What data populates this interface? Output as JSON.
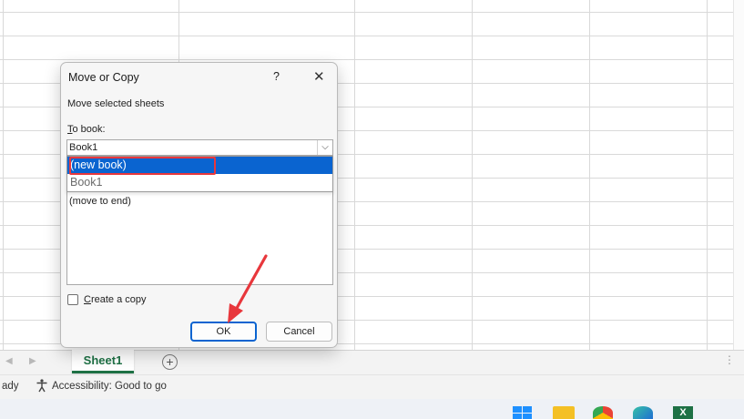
{
  "colors": {
    "accent": "#0a64d0",
    "sheet_green": "#1e7145",
    "annotation_red": "#e8373c"
  },
  "dialog": {
    "title": "Move or Copy",
    "help_label": "?",
    "close_label": "✕",
    "subtitle": "Move selected sheets",
    "to_book_accel": "T",
    "to_book_rest": "o book:",
    "combo_value": "Book1",
    "combo_arrow": "⌵",
    "dropdown_items": [
      "(new book)",
      "Book1"
    ],
    "before_sheet_items": [
      "(move to end)"
    ],
    "copy_checkbox_accel": "C",
    "copy_checkbox_rest": "reate a copy",
    "copy_checked": false,
    "ok_label": "OK",
    "cancel_label": "Cancel"
  },
  "sheet_tabs": {
    "nav_prev": "◀",
    "nav_next": "▶",
    "active_tab": "Sheet1",
    "add_label": "+",
    "more_label": "⋮"
  },
  "status_bar": {
    "ready_text": "ady",
    "accessibility_icon": "accessibility-icon",
    "accessibility_text": "Accessibility: Good to go"
  },
  "taskbar": {
    "icons": [
      "windows-start-icon",
      "file-explorer-icon",
      "chrome-icon",
      "edge-icon",
      "excel-icon"
    ],
    "excel_letter": "X"
  }
}
